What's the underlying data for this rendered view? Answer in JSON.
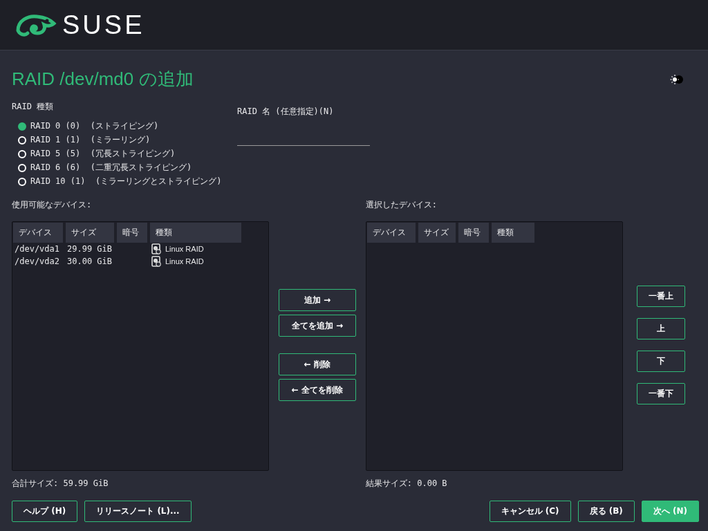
{
  "header": {
    "logo_text": "SUSE"
  },
  "title": "RAID /dev/md0 の追加",
  "raid_type": {
    "label": "RAID 種類",
    "options": [
      {
        "label": "RAID 0 (0)",
        "description": "(ストライピング)",
        "selected": true
      },
      {
        "label": "RAID 1 (1)",
        "description": "(ミラーリング)",
        "selected": false
      },
      {
        "label": "RAID 5 (5)",
        "description": "(冗長ストライピング)",
        "selected": false
      },
      {
        "label": "RAID 6 (6)",
        "description": "(二重冗長ストライピング)",
        "selected": false
      },
      {
        "label": "RAID 10 (1)",
        "description": "(ミラーリングとストライピング)",
        "selected": false
      }
    ]
  },
  "raid_name": {
    "label": "RAID 名 (任意指定)(N)"
  },
  "available_devices": {
    "label": "使用可能なデバイス:",
    "columns": [
      "デバイス",
      "サイズ",
      "暗号",
      "種類"
    ],
    "rows": [
      {
        "device": "/dev/vda1",
        "size": "29.99 GiB",
        "type": "Linux RAID"
      },
      {
        "device": "/dev/vda2",
        "size": "30.00 GiB",
        "type": "Linux RAID"
      }
    ],
    "total": "合計サイズ: 59.99 GiB"
  },
  "transfer_buttons": [
    "追加 →",
    "全てを追加 →",
    "← 削除",
    "← 全てを削除"
  ],
  "selected_devices": {
    "label": "選択したデバイス:",
    "columns": [
      "デバイス",
      "サイズ",
      "暗号",
      "種類"
    ],
    "total": "結果サイズ: 0.00 B"
  },
  "order_buttons": [
    "一番上",
    "上",
    "下",
    "一番下"
  ],
  "footer": {
    "left": [
      "ヘルプ (H)",
      "リリースノート (L)..."
    ],
    "right": [
      {
        "label": "キャンセル (C)",
        "primary": false
      },
      {
        "label": "戻る (B)",
        "primary": false
      },
      {
        "label": "次へ (N)",
        "primary": true
      }
    ]
  }
}
